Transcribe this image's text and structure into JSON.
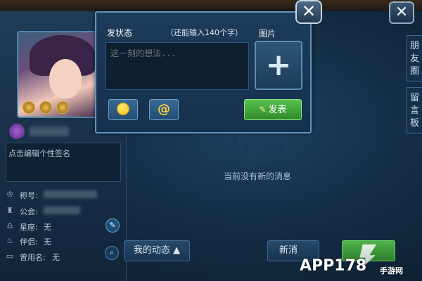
{
  "dialog": {
    "title": "发状态",
    "char_limit": "（还能输入140个字）",
    "image_label": "图片",
    "status_placeholder": "这一刻的想法...",
    "post_label": "发表",
    "close_glyph": "✕"
  },
  "profile": {
    "signature_placeholder": "点击编辑个性签名",
    "rows": [
      {
        "label": "称号:",
        "value": ""
      },
      {
        "label": "公会:",
        "value": ""
      },
      {
        "label": "星座:",
        "value": "无"
      },
      {
        "label": "伴侣:",
        "value": "无"
      },
      {
        "label": "曾用名:",
        "value": "无"
      }
    ]
  },
  "side_tabs": [
    "朋友圈",
    "留言板"
  ],
  "feed": {
    "empty_message": "当前没有新的消息",
    "my_feed_label": "我的动态",
    "new_messages_label": "新消"
  },
  "window": {
    "close_glyph": "✕"
  },
  "watermark": {
    "text": "APP178",
    "sub": "手游网"
  }
}
